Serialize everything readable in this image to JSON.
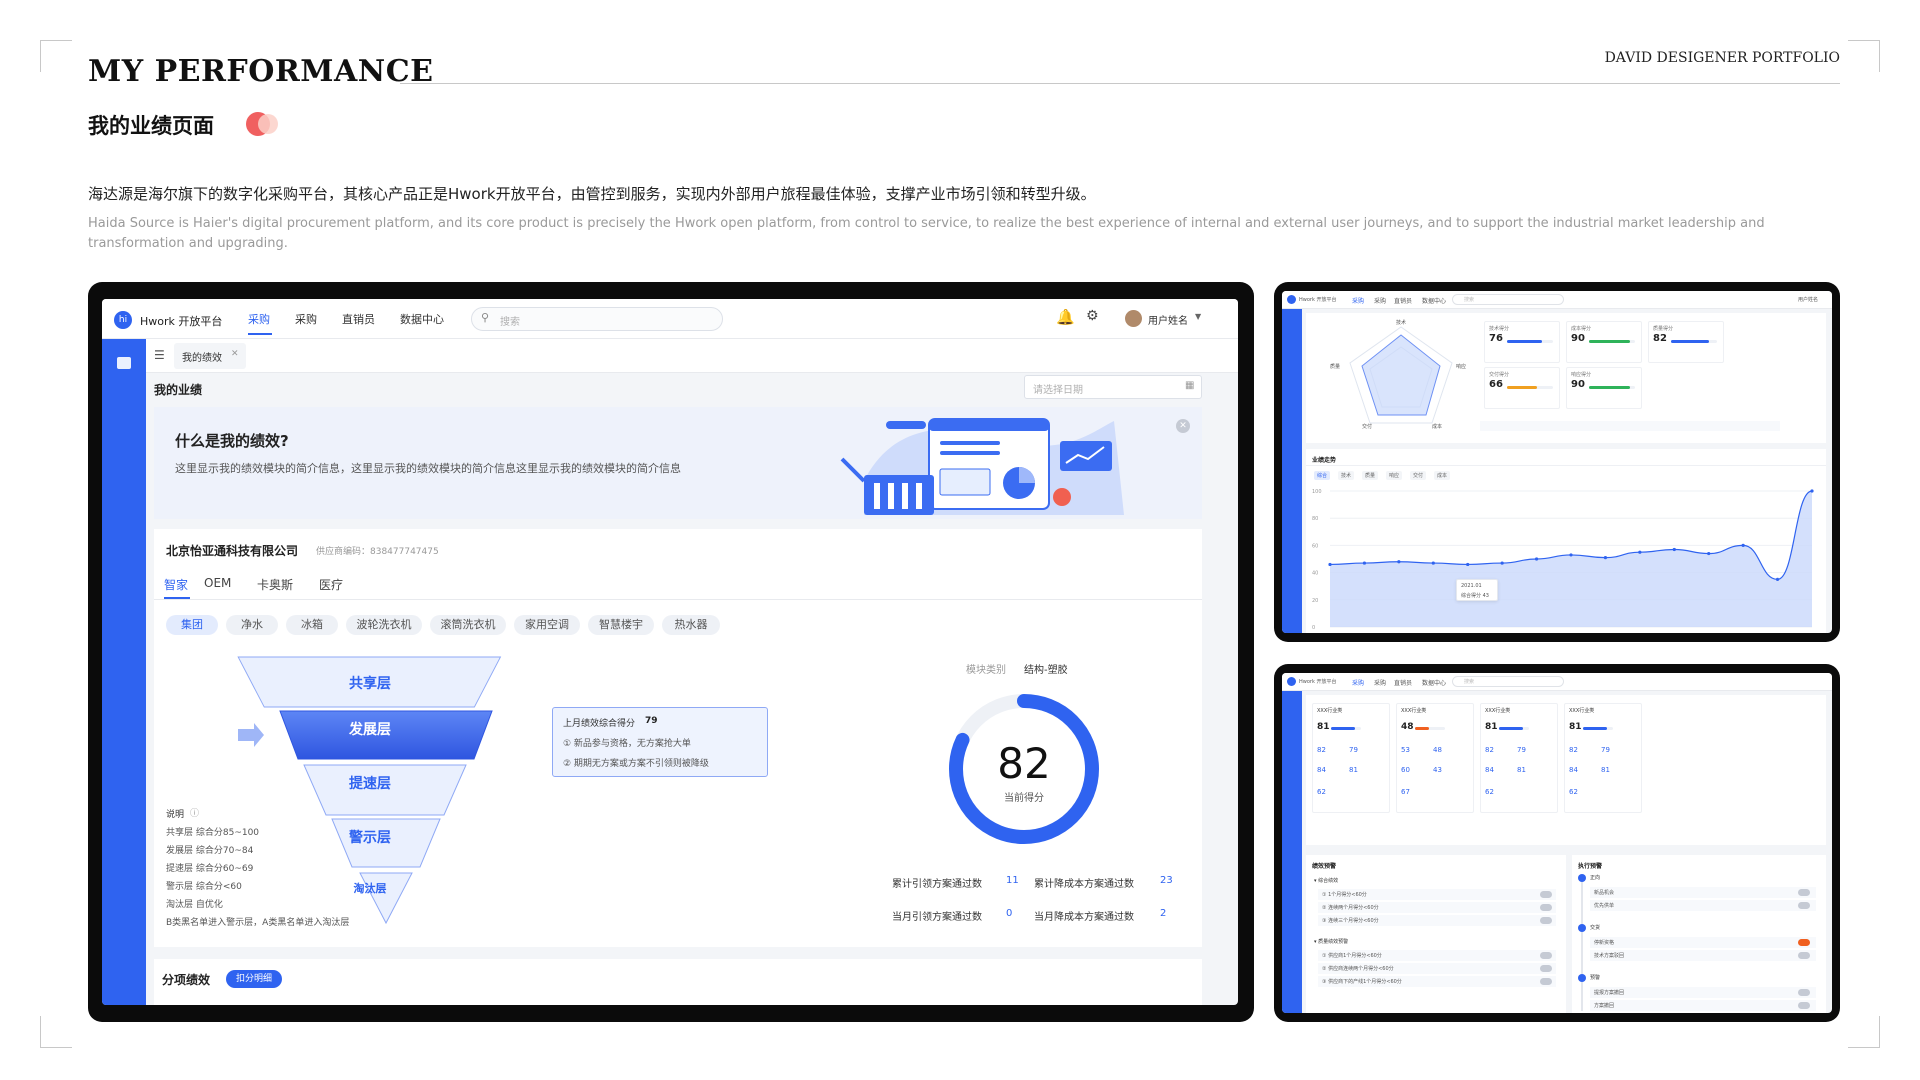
{
  "header": {
    "title_en": "MY PERFORMANCE",
    "portfolio": "DAVID DESIGENER PORTFOLIO",
    "title_cn": "我的业绩页面",
    "desc_cn": "海达源是海尔旗下的数字化采购平台，其核心产品正是Hwork开放平台，由管控到服务，实现内外部用户旅程最佳体验，支撑产业市场引领和转型升级。",
    "desc_en": "Haida Source is Haier's digital procurement platform, and its core product is precisely the Hwork open platform, from control to service, to realize the best experience of internal and external user journeys, and to support the industrial market leadership and transformation and upgrading."
  },
  "app": {
    "logo": "hi",
    "brand": "Hwork 开放平台",
    "nav": [
      "采购",
      "采购",
      "直销员",
      "数据中心"
    ],
    "search_placeholder": "搜索",
    "user": "用户姓名",
    "tab": "我的绩效",
    "page_title": "我的业绩",
    "date_placeholder": "请选择日期",
    "banner_title": "什么是我的绩效?",
    "banner_desc": "这里显示我的绩效模块的简介信息，这里显示我的绩效模块的简介信息这里显示我的绩效模块的简介信息",
    "company": "北京怡亚通科技有限公司",
    "supplier_code": "供应商编码：838477747475",
    "biz_tabs": [
      "智家",
      "OEM",
      "卡奥斯",
      "医疗"
    ],
    "chips": [
      "集团",
      "净水",
      "冰箱",
      "波轮洗衣机",
      "滚筒洗衣机",
      "家用空调",
      "智慧楼宇",
      "热水器"
    ],
    "funnel": [
      "共享层",
      "发展层",
      "提速层",
      "警示层",
      "淘汰层"
    ],
    "tip_title": "上月绩效综合得分",
    "tip_score": "79",
    "tip_lines": [
      "① 新品参与资格，无方案抢大单",
      "② 期期无方案或方案不引领则被降级"
    ],
    "legend_title": "说明",
    "legend": [
      "共享层  综合分85~100",
      "发展层  综合分70~84",
      "提速层  综合分60~69",
      "警示层  综合分<60",
      "淘汰层  自优化",
      "B类黑名单进入警示层，A类黑名单进入淘汰层"
    ],
    "module_label": "模块类别",
    "module_value": "结构-塑胶",
    "score": "82",
    "score_label": "当前得分",
    "score_fraction": 0.82,
    "stats": [
      {
        "label": "累计引领方案通过数",
        "value": "11"
      },
      {
        "label": "累计降成本方案通过数",
        "value": "23"
      },
      {
        "label": "当月引领方案通过数",
        "value": "0"
      },
      {
        "label": "当月降成本方案通过数",
        "value": "2"
      }
    ],
    "bottom_title": "分项绩效",
    "bottom_badge": "扣分明细"
  },
  "mini1": {
    "brand": "Hwork 开放平台",
    "nav": [
      "采购",
      "采购",
      "直销员",
      "数据中心"
    ],
    "search": "搜索",
    "user": "用户姓名",
    "radar_axes": [
      "技术",
      "响应",
      "成本",
      "交付",
      "质量"
    ],
    "scores": [
      {
        "label": "技术得分",
        "value": "76",
        "fill": 0.76,
        "color": "#2f63f0"
      },
      {
        "label": "成本得分",
        "value": "90",
        "fill": 0.9,
        "color": "#2fb35a"
      },
      {
        "label": "质量得分",
        "value": "82",
        "fill": 0.82,
        "color": "#2f63f0"
      },
      {
        "label": "交付得分",
        "value": "66",
        "fill": 0.66,
        "color": "#f0a020"
      },
      {
        "label": "响应得分",
        "value": "90",
        "fill": 0.9,
        "color": "#2fb35a"
      }
    ],
    "trend_title": "业绩走势",
    "trend_tabs": [
      "综合",
      "技术",
      "质量",
      "响应",
      "交付",
      "成本"
    ],
    "y_ticks": [
      "100",
      "80",
      "60",
      "40",
      "20",
      "0"
    ],
    "tooltip": [
      "2021.01",
      "综合得分  43"
    ],
    "line_values": [
      46,
      47,
      48,
      47,
      46,
      47,
      50,
      53,
      51,
      55,
      57,
      54,
      60,
      35,
      100
    ]
  },
  "mini2": {
    "brand": "Hwork 开放平台",
    "nav": [
      "采购",
      "采购",
      "直销员",
      "数据中心"
    ],
    "search": "搜索",
    "cards": [
      {
        "title": "XXX行业类",
        "score": "81",
        "fill": 0.81,
        "color": "#2f63f0",
        "vals": [
          "82",
          "79",
          "84",
          "81",
          "62"
        ]
      },
      {
        "title": "XXX行业类",
        "score": "48",
        "fill": 0.48,
        "color": "#f06020",
        "vals": [
          "53",
          "48",
          "60",
          "43",
          "67"
        ]
      },
      {
        "title": "XXX行业类",
        "score": "81",
        "fill": 0.81,
        "color": "#2f63f0",
        "vals": [
          "82",
          "79",
          "84",
          "81",
          "62"
        ]
      },
      {
        "title": "XXX行业类",
        "score": "81",
        "fill": 0.81,
        "color": "#2f63f0",
        "vals": [
          "82",
          "79",
          "84",
          "81",
          "62"
        ]
      }
    ],
    "left_title": "绩效预警",
    "left_groups": [
      "综合绩效",
      "质量绩效预警"
    ],
    "left_items": [
      "① 1个月得分<60分",
      "② 连续两个月得分<60分",
      "③ 连续三个月得分<60分",
      "① 供应商1个月得分<60分",
      "② 供应商连续两个月得分<60分",
      "③ 供应商下的产线1个月得分<60分"
    ],
    "right_title": "执行预警",
    "right_groups": [
      "正向",
      "交货",
      "预警"
    ],
    "right_items": [
      "新品机会",
      "优先供单",
      "停新资格",
      "技术方案驳回",
      "提报方案撤回",
      "方案撤回"
    ]
  }
}
